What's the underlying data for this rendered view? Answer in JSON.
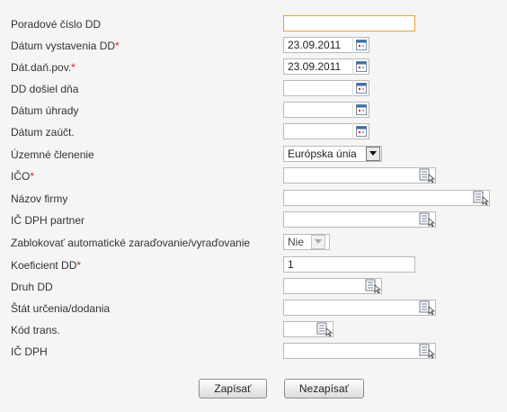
{
  "labels": {
    "poradove_cislo": "Poradové číslo DD",
    "datum_vystavenia": "Dátum vystavenia DD",
    "dat_dan_pov": "Dát.daň.pov.",
    "dd_dosiel": "DD došiel dňa",
    "datum_uhrady": "Dátum úhrady",
    "datum_zauct": "Dátum zaúčt.",
    "uzemne_clenenie": "Územné členenie",
    "ico": "IČO",
    "nazov_firmy": "Názov firmy",
    "ic_dph_partner": "IČ DPH partner",
    "zablokovat": "Zablokovať automatické zaraďovanie/vyraďovanie",
    "koeficient": "Koeficient DD",
    "druh_dd": "Druh DD",
    "stat": "Štát určenia/dodania",
    "kod_trans": "Kód trans.",
    "ic_dph": "IČ DPH"
  },
  "required_mark": "*",
  "values": {
    "poradove_cislo": "",
    "datum_vystavenia": "23.09.2011",
    "dat_dan_pov": "23.09.2011",
    "dd_dosiel": "",
    "datum_uhrady": "",
    "datum_zauct": "",
    "uzemne_clenenie": "Európska únia",
    "ico": "",
    "nazov_firmy": "",
    "ic_dph_partner": "",
    "zablokovat": "Nie",
    "koeficient": "1",
    "druh_dd": "",
    "stat": "",
    "kod_trans": "",
    "ic_dph": ""
  },
  "buttons": {
    "save": "Zapísať",
    "cancel": "Nezapísať"
  },
  "icons": {
    "date_picker": "calendar-icon",
    "lookup": "lookup-list-icon",
    "dropdown": "chevron-down-icon"
  },
  "colors": {
    "required": "#d21e1e",
    "focus_border": "#e3a437",
    "calendar_top": "#3c6ea8",
    "calendar_mark": "#cc2b2b"
  }
}
